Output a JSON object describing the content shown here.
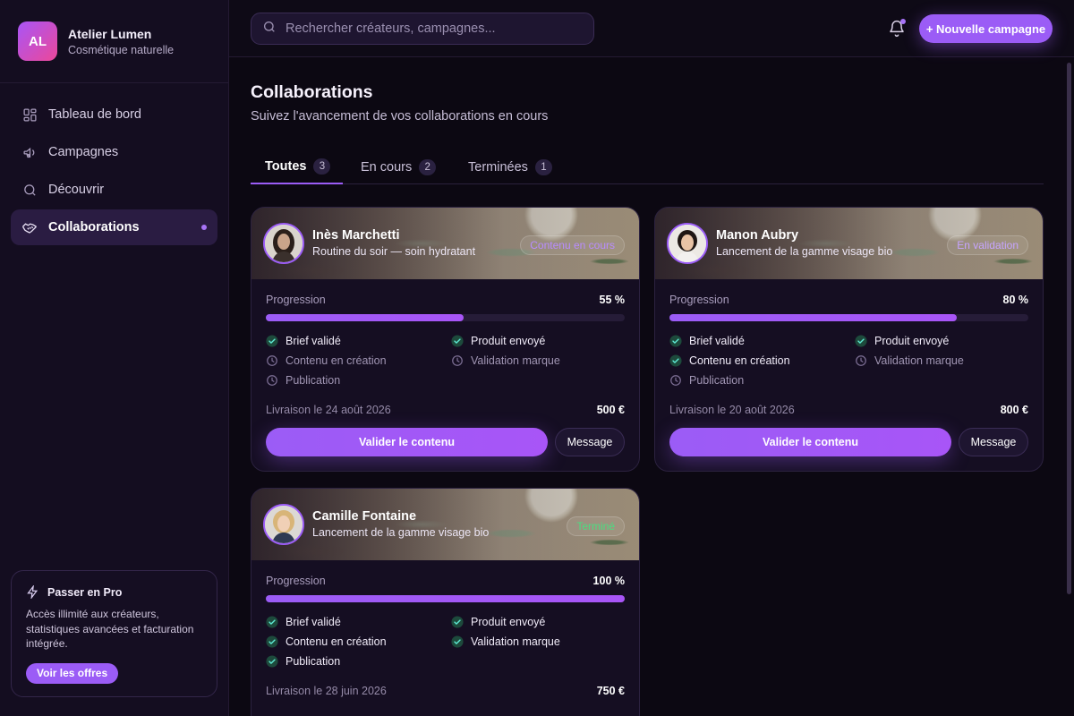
{
  "brand": {
    "initials": "AL",
    "name": "Atelier Lumen",
    "subtitle": "Cosmétique naturelle"
  },
  "nav": {
    "items": [
      {
        "label": "Tableau de bord",
        "icon": "dashboard-icon"
      },
      {
        "label": "Campagnes",
        "icon": "megaphone-icon"
      },
      {
        "label": "Découvrir",
        "icon": "search-icon"
      },
      {
        "label": "Collaborations",
        "icon": "handshake-icon",
        "active": true
      }
    ]
  },
  "promo": {
    "title": "Passer en Pro",
    "text": "Accès illimité aux créateurs, statistiques avancées et facturation intégrée.",
    "button": "Voir les offres"
  },
  "topbar": {
    "search_placeholder": "Rechercher créateurs, campagnes...",
    "new_button": "+ Nouvelle campagne"
  },
  "page": {
    "title": "Collaborations",
    "subtitle": "Suivez l'avancement de vos collaborations en cours"
  },
  "tabs": [
    {
      "label": "Toutes",
      "count": "3",
      "active": true
    },
    {
      "label": "En cours",
      "count": "2"
    },
    {
      "label": "Terminées",
      "count": "1"
    }
  ],
  "colors": {
    "accent": "#9b5cf6",
    "done": "#4ade80",
    "background": "#0c0812"
  },
  "cards": [
    {
      "name": "Inès Marchetti",
      "campaign": "Routine du soir — soin hydratant",
      "status": "Contenu en cours",
      "progress_label": "Progression",
      "progress_text": "55 %",
      "progress": 0.55,
      "steps": [
        {
          "label": "Brief validé",
          "done": true
        },
        {
          "label": "Produit envoyé",
          "done": true
        },
        {
          "label": "Contenu en création",
          "done": false
        },
        {
          "label": "Validation marque",
          "done": false
        },
        {
          "label": "Publication",
          "done": false
        }
      ],
      "delivery": "Livraison le 24 août 2026",
      "price": "500 €",
      "validate_label": "Valider le contenu",
      "message_label": "Message"
    },
    {
      "name": "Manon Aubry",
      "campaign": "Lancement de la gamme visage bio",
      "status": "En validation",
      "progress_label": "Progression",
      "progress_text": "80 %",
      "progress": 0.8,
      "steps": [
        {
          "label": "Brief validé",
          "done": true
        },
        {
          "label": "Produit envoyé",
          "done": true
        },
        {
          "label": "Contenu en création",
          "done": true
        },
        {
          "label": "Validation marque",
          "done": false
        },
        {
          "label": "Publication",
          "done": false
        }
      ],
      "delivery": "Livraison le 20 août 2026",
      "price": "800 €",
      "validate_label": "Valider le contenu",
      "message_label": "Message"
    },
    {
      "name": "Camille Fontaine",
      "campaign": "Lancement de la gamme visage bio",
      "status": "Terminé",
      "progress_label": "Progression",
      "progress_text": "100 %",
      "progress": 1.0,
      "steps": [
        {
          "label": "Brief validé",
          "done": true
        },
        {
          "label": "Produit envoyé",
          "done": true
        },
        {
          "label": "Contenu en création",
          "done": true
        },
        {
          "label": "Validation marque",
          "done": true
        },
        {
          "label": "Publication",
          "done": true
        }
      ],
      "delivery": "Livraison le 28 juin 2026",
      "price": "750 €"
    }
  ]
}
